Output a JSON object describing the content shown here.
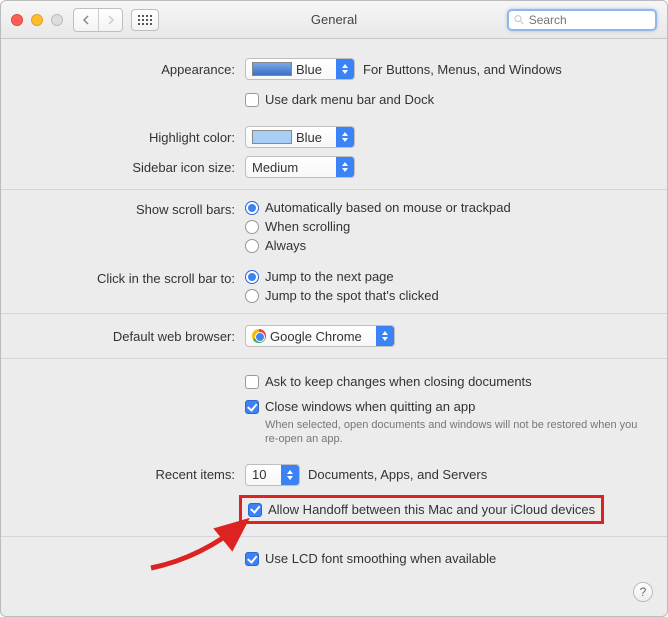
{
  "window": {
    "title": "General"
  },
  "search": {
    "placeholder": "Search"
  },
  "labels": {
    "appearance": "Appearance:",
    "highlight": "Highlight color:",
    "sidebar": "Sidebar icon size:",
    "scrollbars": "Show scroll bars:",
    "scrollclick": "Click in the scroll bar to:",
    "browser": "Default web browser:",
    "recent": "Recent items:"
  },
  "appearance": {
    "value": "Blue",
    "hint": "For Buttons, Menus, and Windows",
    "darkmenu": "Use dark menu bar and Dock"
  },
  "highlight": {
    "value": "Blue"
  },
  "sidebar": {
    "value": "Medium"
  },
  "scrollbars": {
    "opt_auto": "Automatically based on mouse or trackpad",
    "opt_scroll": "When scrolling",
    "opt_always": "Always",
    "selected": "auto"
  },
  "scrollclick": {
    "opt_next": "Jump to the next page",
    "opt_spot": "Jump to the spot that's clicked",
    "selected": "next"
  },
  "browser": {
    "value": "Google Chrome"
  },
  "documents": {
    "ask": "Ask to keep changes when closing documents",
    "closewin": "Close windows when quitting an app",
    "closewin_note": "When selected, open documents and windows will not be restored when you re-open an app."
  },
  "recent": {
    "value": "10",
    "suffix": "Documents, Apps, and Servers"
  },
  "handoff": {
    "label": "Allow Handoff between this Mac and your iCloud devices"
  },
  "lcd": {
    "label": "Use LCD font smoothing when available"
  }
}
